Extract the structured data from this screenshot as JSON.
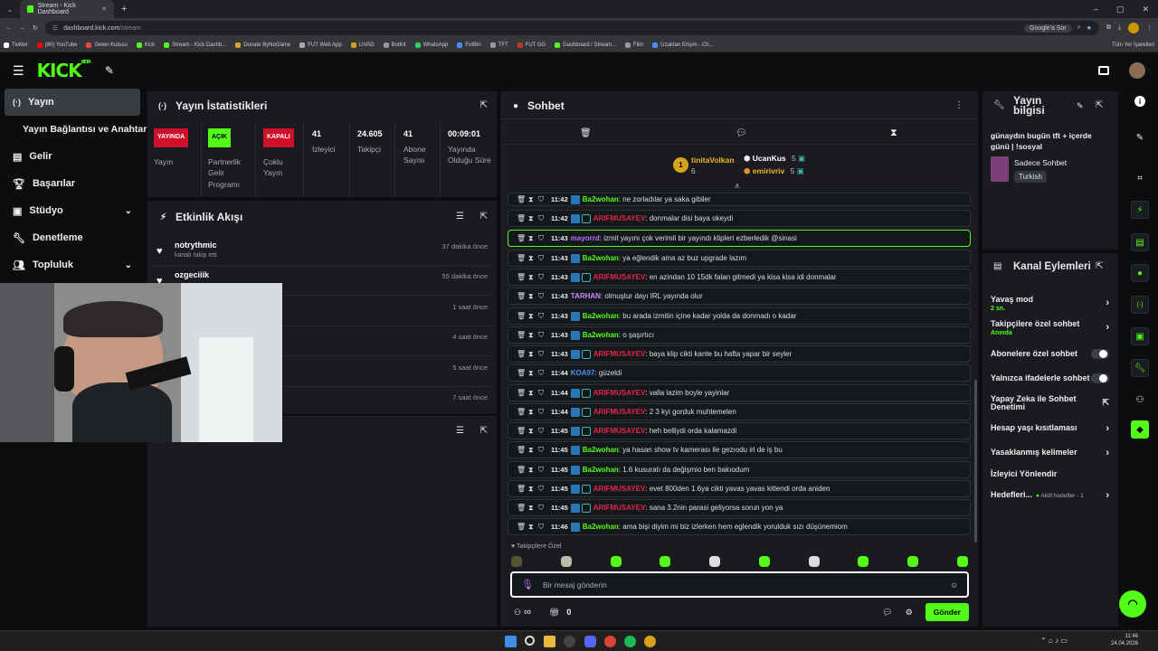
{
  "browser": {
    "tab_title": "Stream - Kick Dashboard",
    "url_host": "dashboard.kick.com",
    "url_path": "/stream",
    "google_label": "Google'a Sor",
    "bookmarks": [
      "Twitter",
      "(80) YouTube",
      "Gelen Kutusu",
      "Kick",
      "Stream - Kick Dashb...",
      "Donate ByNoGame",
      "FUT Web App",
      "LIVAD",
      "BotKit",
      "WhatsApp",
      "FutBin",
      "TFT",
      "FUT GG",
      "Dashboard / Stream...",
      "Film",
      "Uzaktan Erişim - Ch..."
    ],
    "all_bookmarks": "Tüm Yer İşaretleri"
  },
  "header": {
    "logo": "KICK",
    "beta": "BETA"
  },
  "sidebar": {
    "items": [
      {
        "label": "Yayın"
      },
      {
        "label": "Yayın Bağlantısı ve Anahtarı"
      },
      {
        "label": "Gelir"
      },
      {
        "label": "Başarılar"
      },
      {
        "label": "Stüdyo"
      },
      {
        "label": "Denetleme"
      },
      {
        "label": "Topluluk"
      }
    ]
  },
  "stats": {
    "title": "Yayın İstatistikleri",
    "status_live": "YAYINDA",
    "status_live_label": "Yayın",
    "partner_badge": "AÇIK",
    "partner_label": "Partnerlik Gelir Programı",
    "multi_badge": "KAPALI",
    "multi_label": "Çoklu Yayın",
    "viewers": "41",
    "viewers_label": "İzleyici",
    "followers": "24.605",
    "followers_label": "Takipçi",
    "subs": "41",
    "subs_label": "Abone Sayısı",
    "uptime": "00:09:01",
    "uptime_label": "Yayında Olduğu Süre"
  },
  "activity": {
    "title": "Etkinlik Akışı",
    "items": [
      {
        "name": "notrythmic",
        "sub": "kanalı takip etti",
        "time": "37 dakika önce"
      },
      {
        "name": "ozgeciiik",
        "sub": "",
        "time": "55 dakika önce"
      },
      {
        "name": "",
        "sub": "",
        "time": "1 saat önce"
      },
      {
        "name": "",
        "sub": "",
        "time": "4 saat önce"
      },
      {
        "name": "",
        "sub": "",
        "time": "5 saat önce"
      },
      {
        "name": "",
        "sub": "",
        "time": "7 saat önce"
      }
    ]
  },
  "chat": {
    "title": "Sohbet",
    "top_users": [
      {
        "rank": "1",
        "name": "tinitaVolkan",
        "count": "6"
      },
      {
        "name": "UcanKus",
        "count": "5"
      },
      {
        "name": "emirivriv",
        "count": "5"
      }
    ],
    "messages": [
      {
        "time": "11:42",
        "user": "Ba2wohan",
        "color": "#53fc18",
        "badges": 1,
        "text": "ne zorladılar ya saka gibiler"
      },
      {
        "time": "11:42",
        "user": "ARIFMUSAYEV",
        "color": "#e0264a",
        "badges": 2,
        "text": "donmalar disi baya okeydi"
      },
      {
        "time": "11:43",
        "user": "mayorrd",
        "color": "#b472ff",
        "badges": 0,
        "text": "izmit yayını çok verimli bir yayındı klipleri ezberledik @sinasi",
        "highlight": true
      },
      {
        "time": "11:43",
        "user": "Ba2wohan",
        "color": "#53fc18",
        "badges": 1,
        "text": "ya eğlendik ama az buz upgrade lazım"
      },
      {
        "time": "11:43",
        "user": "ARIFMUSAYEV",
        "color": "#e0264a",
        "badges": 2,
        "text": "en azindan 10 15dk falan gitmedi ya kisa kisa idi donmalar"
      },
      {
        "time": "11:43",
        "user": "TARHAN",
        "color": "#c78cff",
        "badges": 0,
        "text": "olmuştur dayı IRL yayında olur"
      },
      {
        "time": "11:43",
        "user": "Ba2wohan",
        "color": "#53fc18",
        "badges": 1,
        "text": "bu arada izmitin içine kadar yolda da donmadı o kadar"
      },
      {
        "time": "11:43",
        "user": "Ba2wohan",
        "color": "#53fc18",
        "badges": 1,
        "text": "o şaşırtıcı"
      },
      {
        "time": "11:43",
        "user": "ARIFMUSAYEV",
        "color": "#e0264a",
        "badges": 2,
        "text": "baya klip cikti kante bu hafta yapar bir seyler"
      },
      {
        "time": "11:44",
        "user": "KOA97",
        "color": "#4b8cff",
        "badges": 0,
        "text": "güzeldi"
      },
      {
        "time": "11:44",
        "user": "ARIFMUSAYEV",
        "color": "#e0264a",
        "badges": 2,
        "text": "valla lazim boyle yayinlar"
      },
      {
        "time": "11:44",
        "user": "ARIFMUSAYEV",
        "color": "#e0264a",
        "badges": 2,
        "text": "2 3 kyi gorduk muhtemelen"
      },
      {
        "time": "11:45",
        "user": "ARIFMUSAYEV",
        "color": "#e0264a",
        "badges": 2,
        "text": "heh belliydi orda kalamazdi"
      },
      {
        "time": "11:45",
        "user": "Ba2wohan",
        "color": "#53fc18",
        "badges": 1,
        "text": "ya hasan show tv kamerası ile gezıodu irl de iş bu"
      },
      {
        "time": "11:45",
        "user": "Ba2wohan",
        "color": "#53fc18",
        "badges": 1,
        "text": "1.6 kusuratı da değişmio ben bakıodum"
      },
      {
        "time": "11:45",
        "user": "ARIFMUSAYEV",
        "color": "#e0264a",
        "badges": 2,
        "text": "evet 800den 1.6ya cikti yavas yavas kitlendi orda aniden"
      },
      {
        "time": "11:45",
        "user": "ARIFMUSAYEV",
        "color": "#e0264a",
        "badges": 2,
        "text": "sana 3.2nin parasi geliyorsa sorun yon ya"
      },
      {
        "time": "11:46",
        "user": "Ba2wohan",
        "color": "#53fc18",
        "badges": 1,
        "text": "ama bişi diyim mi biz izlerken hem eglendik yorulduk sızı düşünemiom"
      }
    ],
    "emote_section": "Takipçilere Özel",
    "input_placeholder": "Bir mesaj gönderin",
    "infinity": "∞",
    "gift_count": "0",
    "send_label": "Gönder"
  },
  "stream_info": {
    "title": "Yayın bilgisi",
    "stream_title": "günaydın bugün tft + içerde günü | !sosyal",
    "category": "Sadece Sohbet",
    "language": "Turkish"
  },
  "channel_actions": {
    "title": "Kanal Eylemleri",
    "items": [
      {
        "label": "Yavaş mod",
        "sub": "2 sn.",
        "kind": "chev"
      },
      {
        "label": "Takipçilere özel sohbet",
        "sub": "Anında",
        "kind": "chev"
      },
      {
        "label": "Abonelere özel sohbet",
        "sub": "",
        "kind": "toggle"
      },
      {
        "label": "Yalnızca ifadelerle sohbet",
        "sub": "",
        "kind": "toggle"
      },
      {
        "label": "Yapay Zeka ile Sohbet Denetimi",
        "sub": "",
        "kind": "ext"
      },
      {
        "label": "Hesap yaşı kısıtlaması",
        "sub": "",
        "kind": "chev"
      },
      {
        "label": "Yasaklanmış kelimeler",
        "sub": "",
        "kind": "chev"
      },
      {
        "label": "İzleyici Yönlendir",
        "sub": "",
        "kind": "none"
      },
      {
        "label": "Hedefleri...",
        "sub": "",
        "kind": "goal",
        "extra": "Aktif hedefler - 1"
      }
    ]
  },
  "taskbar": {
    "time": "11:46",
    "date": "24.04.2026"
  },
  "colors": {
    "accent": "#53fc18",
    "panel": "#191b1f",
    "bg": "#0b0d0f",
    "live": "#d20f2a"
  }
}
